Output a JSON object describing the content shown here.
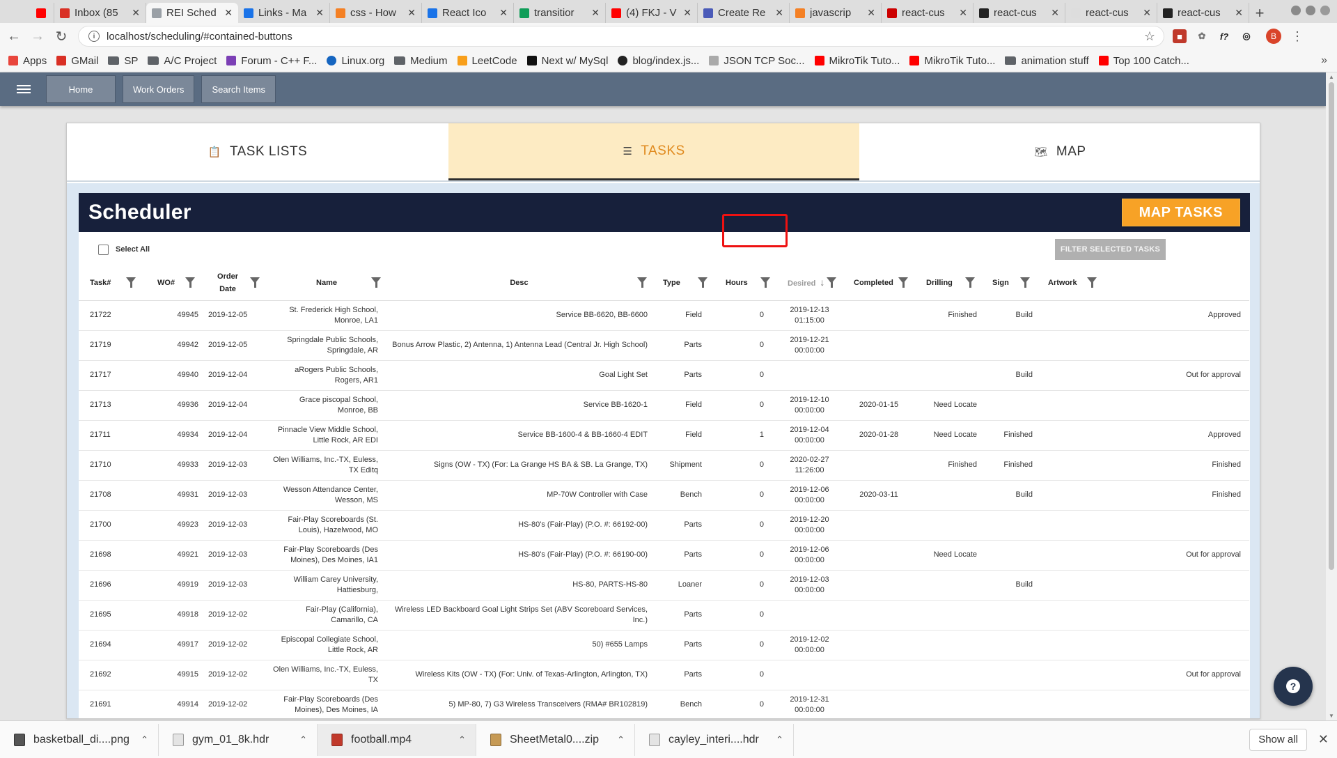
{
  "browser": {
    "tabs": [
      {
        "title": "",
        "favicon_color": "#ff0000"
      },
      {
        "title": "Inbox (85",
        "favicon_color": "#d93025"
      },
      {
        "title": "REI Sched",
        "favicon_color": "#9aa0a6",
        "active": true
      },
      {
        "title": "Links - Ma",
        "favicon_color": "#1a73e8"
      },
      {
        "title": "css - How",
        "favicon_color": "#f48024"
      },
      {
        "title": "React Ico",
        "favicon_color": "#1a73e8"
      },
      {
        "title": "transitior",
        "favicon_color": "#0f9d58"
      },
      {
        "title": "(4) FKJ - V",
        "favicon_color": "#ff0000"
      },
      {
        "title": "Create Re",
        "favicon_color": "#4a5ab8"
      },
      {
        "title": "javascrip",
        "favicon_color": "#f48024"
      },
      {
        "title": "react-cus",
        "favicon_color": "#cc0000"
      },
      {
        "title": "react-cus",
        "favicon_color": "#222222"
      },
      {
        "title": "react-cus",
        "favicon_color": "#dddddd"
      },
      {
        "title": "react-cus",
        "favicon_color": "#222222"
      }
    ],
    "new_tab": "+",
    "url": "localhost/scheduling/#contained-buttons",
    "profile_initial": "B",
    "bookmarks": [
      {
        "label": "Apps",
        "icon": "apps-grid-icon"
      },
      {
        "label": "GMail",
        "icon": "gmail-icon"
      },
      {
        "label": "SP",
        "icon": "folder-icon"
      },
      {
        "label": "A/C Project",
        "icon": "folder-icon"
      },
      {
        "label": "Forum - C++ F...",
        "icon": "forum-icon"
      },
      {
        "label": "Linux.org",
        "icon": "globe-icon"
      },
      {
        "label": "Medium",
        "icon": "folder-icon"
      },
      {
        "label": "LeetCode",
        "icon": "leetcode-icon"
      },
      {
        "label": "Next w/ MySql",
        "icon": "triangle-icon"
      },
      {
        "label": "blog/index.js...",
        "icon": "github-icon"
      },
      {
        "label": "JSON TCP Soc...",
        "icon": "doc-icon"
      },
      {
        "label": "MikroTik Tuto...",
        "icon": "youtube-icon"
      },
      {
        "label": "MikroTik Tuto...",
        "icon": "youtube-icon"
      },
      {
        "label": "animation stuff",
        "icon": "folder-icon"
      },
      {
        "label": "Top 100 Catch...",
        "icon": "youtube-icon"
      }
    ]
  },
  "app": {
    "nav": {
      "home": "Home",
      "work_orders": "Work Orders",
      "search_items": "Search Items"
    },
    "tabs": {
      "task_lists": "TASK LISTS",
      "tasks": "TASKS",
      "map": "MAP"
    },
    "scheduler": {
      "title": "Scheduler",
      "map_tasks": "MAP TASKS",
      "select_all": "Select All",
      "filter_selected": "FILTER SELECTED TASKS"
    },
    "columns": {
      "task": "Task#",
      "wo": "WO#",
      "order_date": "Order Date",
      "name": "Name",
      "desc": "Desc",
      "type": "Type",
      "hours": "Hours",
      "desired": "Desired",
      "completed": "Completed",
      "drilling": "Drilling",
      "sign": "Sign",
      "artwork": "Artwork"
    },
    "rows": [
      {
        "task": "21722",
        "wo": "49945",
        "date": "2019-12-05",
        "name": "St. Frederick High School, Monroe, LA1",
        "desc": "Service BB-6620, BB-6600",
        "type": "Field",
        "hours": "0",
        "desired": "2019-12-13 01:15:00",
        "completed": "",
        "drilling": "Finished",
        "sign": "Build",
        "artwork": "Approved"
      },
      {
        "task": "21719",
        "wo": "49942",
        "date": "2019-12-05",
        "name": "Springdale Public Schools, Springdale, AR",
        "desc": "Bonus Arrow Plastic, 2) Antenna, 1) Antenna Lead (Central Jr. High School)",
        "type": "Parts",
        "hours": "0",
        "desired": "2019-12-21 00:00:00",
        "completed": "",
        "drilling": "",
        "sign": "",
        "artwork": ""
      },
      {
        "task": "21717",
        "wo": "49940",
        "date": "2019-12-04",
        "name": "aRogers Public Schools, Rogers, AR1",
        "desc": "Goal Light Set",
        "type": "Parts",
        "hours": "0",
        "desired": "",
        "completed": "",
        "drilling": "",
        "sign": "Build",
        "artwork": "Out for approval"
      },
      {
        "task": "21713",
        "wo": "49936",
        "date": "2019-12-04",
        "name": "Grace piscopal School, Monroe, BB",
        "desc": "Service BB-1620-1",
        "type": "Field",
        "hours": "0",
        "desired": "2019-12-10 00:00:00",
        "completed": "2020-01-15",
        "drilling": "Need Locate",
        "sign": "",
        "artwork": ""
      },
      {
        "task": "21711",
        "wo": "49934",
        "date": "2019-12-04",
        "name": "Pinnacle View Middle School, Little Rock, AR EDI",
        "desc": "Service BB-1600-4 & BB-1660-4 EDIT",
        "type": "Field",
        "hours": "1",
        "desired": "2019-12-04 00:00:00",
        "completed": "2020-01-28",
        "drilling": "Need Locate",
        "sign": "Finished",
        "artwork": "Approved"
      },
      {
        "task": "21710",
        "wo": "49933",
        "date": "2019-12-03",
        "name": "Olen Williams, Inc.-TX, Euless, TX Editq",
        "desc": "Signs (OW - TX) (For: La Grange HS BA & SB. La Grange, TX)",
        "type": "Shipment",
        "hours": "0",
        "desired": "2020-02-27 11:26:00",
        "completed": "",
        "drilling": "Finished",
        "sign": "Finished",
        "artwork": "Finished"
      },
      {
        "task": "21708",
        "wo": "49931",
        "date": "2019-12-03",
        "name": "Wesson Attendance Center, Wesson, MS",
        "desc": "MP-70W Controller with Case",
        "type": "Bench",
        "hours": "0",
        "desired": "2019-12-06 00:00:00",
        "completed": "2020-03-11",
        "drilling": "",
        "sign": "Build",
        "artwork": "Finished"
      },
      {
        "task": "21700",
        "wo": "49923",
        "date": "2019-12-03",
        "name": "Fair-Play Scoreboards (St. Louis), Hazelwood, MO",
        "desc": "HS-80's (Fair-Play) (P.O. #: 66192-00)",
        "type": "Parts",
        "hours": "0",
        "desired": "2019-12-20 00:00:00",
        "completed": "",
        "drilling": "",
        "sign": "",
        "artwork": ""
      },
      {
        "task": "21698",
        "wo": "49921",
        "date": "2019-12-03",
        "name": "Fair-Play Scoreboards (Des Moines), Des Moines, IA1",
        "desc": "HS-80's (Fair-Play) (P.O. #: 66190-00)",
        "type": "Parts",
        "hours": "0",
        "desired": "2019-12-06 00:00:00",
        "completed": "",
        "drilling": "Need Locate",
        "sign": "",
        "artwork": "Out for approval"
      },
      {
        "task": "21696",
        "wo": "49919",
        "date": "2019-12-03",
        "name": "William Carey University, Hattiesburg,",
        "desc": "HS-80, PARTS-HS-80",
        "type": "Loaner",
        "hours": "0",
        "desired": "2019-12-03 00:00:00",
        "completed": "",
        "drilling": "",
        "sign": "Build",
        "artwork": ""
      },
      {
        "task": "21695",
        "wo": "49918",
        "date": "2019-12-02",
        "name": "Fair-Play (California), Camarillo, CA",
        "desc": "Wireless LED Backboard Goal Light Strips Set (ABV Scoreboard Services, Inc.)",
        "type": "Parts",
        "hours": "0",
        "desired": "",
        "completed": "",
        "drilling": "",
        "sign": "",
        "artwork": ""
      },
      {
        "task": "21694",
        "wo": "49917",
        "date": "2019-12-02",
        "name": "Episcopal Collegiate School, Little Rock, AR",
        "desc": "50) #655 Lamps",
        "type": "Parts",
        "hours": "0",
        "desired": "2019-12-02 00:00:00",
        "completed": "",
        "drilling": "",
        "sign": "",
        "artwork": ""
      },
      {
        "task": "21692",
        "wo": "49915",
        "date": "2019-12-02",
        "name": "Olen Williams, Inc.-TX, Euless, TX",
        "desc": "Wireless Kits (OW - TX) (For: Univ. of Texas-Arlington, Arlington, TX)",
        "type": "Parts",
        "hours": "0",
        "desired": "",
        "completed": "",
        "drilling": "",
        "sign": "",
        "artwork": "Out for approval"
      },
      {
        "task": "21691",
        "wo": "49914",
        "date": "2019-12-02",
        "name": "Fair-Play Scoreboards (Des Moines), Des Moines, IA",
        "desc": "5) MP-80, 7) G3 Wireless Transceivers (RMA# BR102819)",
        "type": "Bench",
        "hours": "0",
        "desired": "2019-12-31 00:00:00",
        "completed": "",
        "drilling": "",
        "sign": "",
        "artwork": ""
      }
    ],
    "help_label": "?"
  },
  "downloads": {
    "items": [
      {
        "name": "basketball_di....png",
        "icon": "image-file-icon"
      },
      {
        "name": "gym_01_8k.hdr",
        "icon": "file-icon"
      },
      {
        "name": "football.mp4",
        "icon": "video-file-icon"
      },
      {
        "name": "SheetMetal0....zip",
        "icon": "zip-file-icon"
      },
      {
        "name": "cayley_interi....hdr",
        "icon": "file-icon"
      }
    ],
    "show_all": "Show all"
  },
  "colors": {
    "app_header": "#5a6c82",
    "scheduler_header": "#17203b",
    "accent_orange": "#f7a226",
    "active_tab_bg": "#fdebc3",
    "highlight": "#ee1111"
  }
}
